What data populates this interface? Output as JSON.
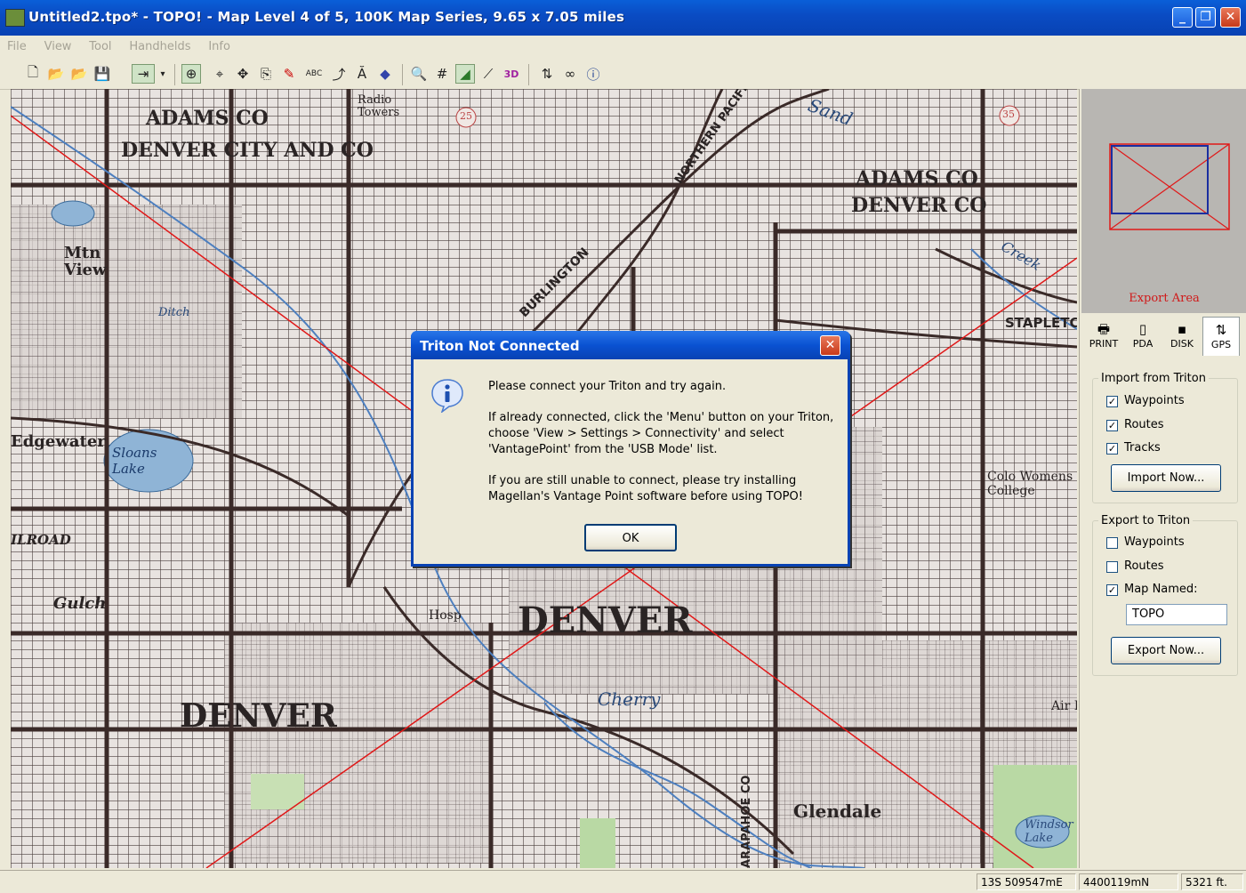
{
  "window": {
    "title": "Untitled2.tpo* - TOPO! - Map Level 4 of 5, 100K Map Series, 9.65 x 7.05 miles",
    "controls": {
      "minimize": "_",
      "maximize": "❐",
      "close": "✕"
    }
  },
  "menu": [
    "File",
    "View",
    "Tool",
    "Handhelds",
    "Info"
  ],
  "toolbar": {
    "icons": [
      "new-icon",
      "open-icon",
      "open-alt-icon",
      "save-icon",
      "export-route-icon",
      "dropdown-icon",
      "zoom-in-icon",
      "center-icon",
      "pan-icon",
      "copy-icon",
      "pin-icon",
      "text-tool-icon",
      "route-tool-icon",
      "north-icon",
      "diamond-icon",
      "search-icon",
      "grid-icon",
      "shaded-relief-icon",
      "profile-icon",
      "3d-icon",
      "gps-transfer-icon",
      "binoculars-icon",
      "info-icon"
    ],
    "text_3d": "3D",
    "text_abc": "ABC"
  },
  "map": {
    "labels": {
      "adams_co_top": "ADAMS CO",
      "denver_city_co": "DENVER CITY AND CO",
      "adams_co_right": "ADAMS CO",
      "denver_co_right": "DENVER CO",
      "mtn_view": "Mtn View",
      "edgewater": "Edgewater",
      "sloans_lake": "Sloans Lake",
      "denver_center": "DENVER",
      "denver_left": "DENVER",
      "glendale": "Glendale",
      "stapleton": "STAPLETC",
      "colo_womens": "Colo Womens College",
      "railroad": "ILROAD",
      "gulch": "Gulch",
      "burlington": "BURLINGTON",
      "northern_pacific": "NORTHERN PACIFIC",
      "sand": "Sand",
      "creek": "Creek",
      "hosp": "Hosp",
      "radio_towers": "Radio Towers",
      "route_25": "25",
      "route_35": "35",
      "air_fc": "Air Fc",
      "cherry": "Cherry",
      "windsor_lake": "Windsor Lake",
      "arapahoe_co": "ARAPAHOE CO",
      "denver_co_vert": "DENVER CO",
      "ditch": "Ditch"
    }
  },
  "right_panel": {
    "export_area_label": "Export Area",
    "tabs": [
      {
        "label": "PRINT",
        "icon": "printer-icon"
      },
      {
        "label": "PDA",
        "icon": "pda-icon"
      },
      {
        "label": "DISK",
        "icon": "disk-icon"
      },
      {
        "label": "GPS",
        "icon": "gps-icon"
      }
    ],
    "import": {
      "legend": "Import from Triton",
      "waypoints": "Waypoints",
      "routes": "Routes",
      "tracks": "Tracks",
      "button": "Import Now..."
    },
    "export": {
      "legend": "Export to Triton",
      "waypoints": "Waypoints",
      "routes": "Routes",
      "map_named": "Map Named:",
      "map_name_value": "TOPO",
      "button": "Export Now..."
    },
    "check_mark": "✓"
  },
  "dialog": {
    "title": "Triton Not Connected",
    "close": "✕",
    "line1": "Please connect your Triton and try again.",
    "line2": "If already connected, click the 'Menu' button on your Triton,",
    "line3": "choose 'View > Settings > Connectivity' and select",
    "line4": "'VantagePoint' from the 'USB Mode' list.",
    "line5": "If you are still unable to connect, please try installing",
    "line6": "Magellan's Vantage Point software before using TOPO!",
    "ok": "OK"
  },
  "status": {
    "easting": "13S 509547mE",
    "northing": "4400119mN",
    "elevation": "5321 ft."
  },
  "colors": {
    "titlebar": "#0842b3",
    "export_area_red": "#d01818",
    "map_bg": "#e3dedb",
    "map_road": "#3a2a28"
  }
}
